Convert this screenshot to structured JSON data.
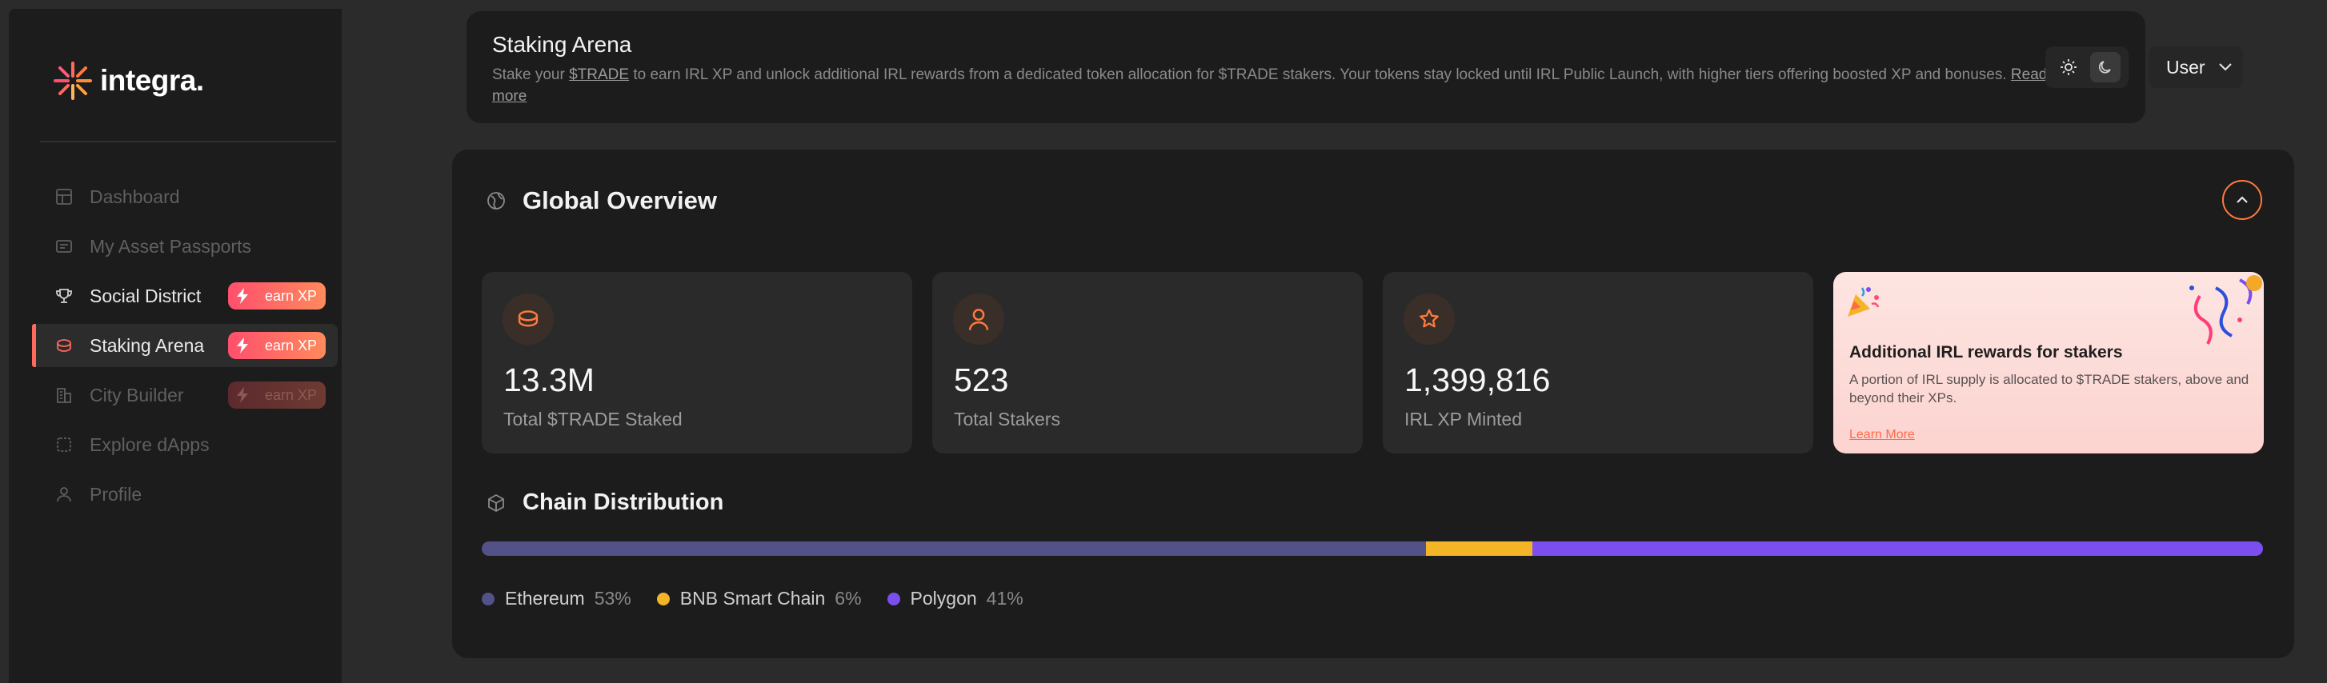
{
  "app": {
    "logo_text": "integra."
  },
  "sidebar": {
    "items": [
      {
        "label": "Dashboard",
        "icon": "grid-icon"
      },
      {
        "label": "My Asset Passports",
        "icon": "passport-icon"
      },
      {
        "label": "Social District",
        "icon": "trophy-icon",
        "badge": "earn XP"
      },
      {
        "label": "Staking Arena",
        "icon": "coins-icon",
        "badge": "earn XP",
        "active": true
      },
      {
        "label": "City Builder",
        "icon": "building-icon",
        "badge": "earn XP"
      },
      {
        "label": "Explore dApps",
        "icon": "apps-icon"
      },
      {
        "label": "Profile",
        "icon": "user-icon"
      }
    ]
  },
  "header": {
    "title": "Staking Arena",
    "desc_pre": "Stake your ",
    "desc_link": "$TRADE",
    "desc_post": " to earn IRL XP and unlock additional IRL rewards from a dedicated token allocation for $TRADE stakers. Your tokens stay locked until IRL Public Launch, with higher tiers offering boosted XP and bonuses. ",
    "read_more": "Read more",
    "user_label": "User"
  },
  "overview": {
    "title": "Global Overview",
    "stats": [
      {
        "value": "13.3M",
        "caption": "Total $TRADE Staked",
        "icon": "coins-icon"
      },
      {
        "value": "523",
        "caption": "Total Stakers",
        "icon": "user-icon"
      },
      {
        "value": "1,399,816",
        "caption": "IRL XP Minted",
        "icon": "star-icon"
      }
    ],
    "promo": {
      "title": "Additional IRL rewards for stakers",
      "text": "A portion of IRL supply is allocated to $TRADE stakers, above and beyond their XPs.",
      "link": "Learn More"
    }
  },
  "distribution": {
    "title": "Chain Distribution",
    "chains": [
      {
        "name": "Ethereum",
        "pct_label": "53%",
        "share": 53,
        "color": "#525288"
      },
      {
        "name": "BNB Smart Chain",
        "pct_label": "6%",
        "share": 6,
        "color": "#f4b428"
      },
      {
        "name": "Polygon",
        "pct_label": "41%",
        "share": 41,
        "color": "#7b4ef0"
      }
    ]
  },
  "colors": {
    "accent": "#ff7a3d",
    "badge_gradient_start": "#ff4f6d",
    "badge_gradient_end": "#ff8a5c"
  }
}
